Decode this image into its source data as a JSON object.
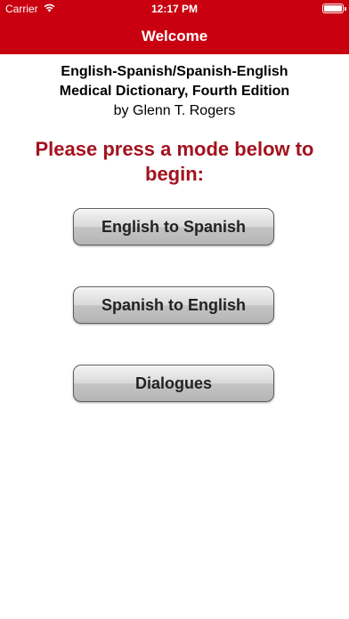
{
  "status_bar": {
    "carrier": "Carrier",
    "time": "12:17 PM",
    "battery_level": 1.0
  },
  "nav": {
    "title": "Welcome"
  },
  "header": {
    "line1": "English-Spanish/Spanish-English",
    "line2": "Medical Dictionary, Fourth Edition",
    "line3": "by Glenn T. Rogers"
  },
  "prompt": "Please press a mode below to begin:",
  "buttons": [
    {
      "label": "English to Spanish"
    },
    {
      "label": "Spanish to English"
    },
    {
      "label": "Dialogues"
    }
  ],
  "colors": {
    "nav_background": "#c8000f",
    "prompt_text": "#a3121f"
  },
  "icons": [
    "wifi-icon",
    "battery-icon"
  ]
}
